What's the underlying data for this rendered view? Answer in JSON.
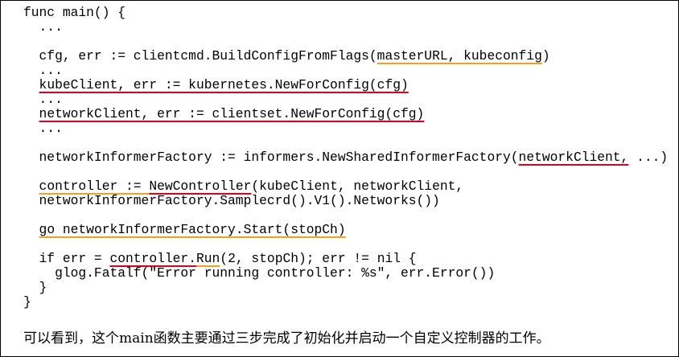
{
  "code": {
    "l01": "func main() {",
    "l02": "  ...",
    "l03": "",
    "l04a": "  cfg, err := clientcmd.BuildConfigFromFlags(",
    "l04b": "masterURL, kubeconfig",
    "l04c": ")",
    "l05": "  ...",
    "l06a": "  ",
    "l06b": "kubeClient, err := kubernetes.NewForConfig(cfg)",
    "l07": "  ...",
    "l08a": "  ",
    "l08b": "networkClient, err := clientset.NewForConfig(cfg)",
    "l09": "  ...",
    "l10": "",
    "l11a": "  networkInformerFactory := informers.NewSharedInformerFactory(",
    "l11b": "networkClient,",
    "l11c": " ...)",
    "l12": "",
    "l13a": "  ",
    "l13b": "controller := ",
    "l13c": "NewController",
    "l13d": "(kubeClient, networkClient,",
    "l14": "  networkInformerFactory.Samplecrd().V1().Networks())",
    "l15": "",
    "l16a": "  ",
    "l16b": "go networkInformerFactory.Start(stopCh)",
    "l17": "",
    "l18a": "  if err = ",
    "l18b": "controller",
    "l18c": ".",
    "l18d": "Run",
    "l18e": "(2, stopCh); err != nil {",
    "l19": "    glog.Fatalf(\"Error running controller: %s\", err.Error())",
    "l20": "  }",
    "l21": "}"
  },
  "caption": "可以看到，这个main函数主要通过三步完成了初始化并启动一个自定义控制器的工作。",
  "colors": {
    "red_underline": "#e0001b",
    "orange_underline": "#f2a21a"
  }
}
